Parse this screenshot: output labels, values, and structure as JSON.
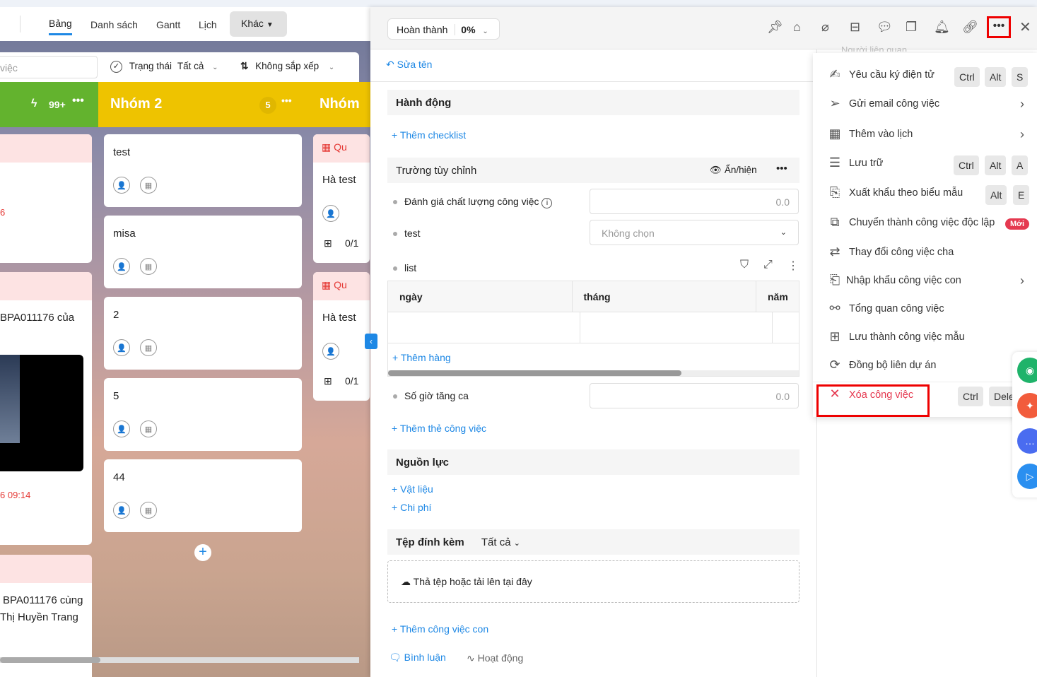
{
  "board": {
    "tabs": [
      "Bảng",
      "Danh sách",
      "Gantt",
      "Lịch"
    ],
    "more_tab": "Khác",
    "search_placeholder": "việc",
    "status_label": "Trạng thái",
    "status_value": "Tất cả",
    "sort_label": "Không sắp xếp",
    "col1": {
      "count": "99+"
    },
    "col2": {
      "title": "Nhóm 2",
      "count": "5"
    },
    "col3": {
      "title": "Nhóm"
    },
    "left_cards": {
      "text1": "6",
      "text2": "BPA011176 của",
      "time": "6 09:14",
      "text3": "BPA011176 cùng",
      "text4": "Thị Huyền Trang"
    },
    "cards": [
      "test",
      "misa",
      "2",
      "5",
      "44"
    ],
    "right_cards": [
      {
        "tag": "Qu",
        "title": "Hà test",
        "sub": "0/1"
      },
      {
        "tag": "Qu",
        "title": "Hà test",
        "sub": "0/1"
      }
    ]
  },
  "panel": {
    "status": "Hoàn thành",
    "progress": "0%",
    "rename": "Sửa tên",
    "actions_title": "Hành động",
    "add_checklist": "Thêm checklist",
    "custom_fields_title": "Trường tùy chỉnh",
    "show_hide": "Ẩn/hiện",
    "fields": [
      {
        "label": "Đánh giá chất lượng công việc",
        "value": "0.0"
      },
      {
        "label": "test",
        "value": "Không chọn"
      },
      {
        "label": "list"
      },
      {
        "label": "Số giờ tăng ca",
        "value": "0.0"
      }
    ],
    "list_columns": [
      "ngày",
      "tháng",
      "năm"
    ],
    "add_row": "Thêm hàng",
    "add_field": "Thêm thẻ công việc",
    "resources_title": "Nguồn lực",
    "materials": "Vật liệu",
    "costs": "Chi phí",
    "attachments_title": "Tệp đính kèm",
    "attachments_filter": "Tất cả",
    "upload": "Thả tệp hoặc tải lên tại đây",
    "add_subtask": "Thêm công việc con",
    "comments_tab": "Bình luận",
    "activity_tab": "Hoạt động"
  },
  "menu": {
    "top_hidden": "Người liên quan",
    "items": [
      {
        "label": "Yêu cầu ký điện tử",
        "keys": [
          "Ctrl",
          "Alt",
          "S"
        ]
      },
      {
        "label": "Gửi email công việc",
        "submenu": true
      },
      {
        "label": "Thêm vào lịch",
        "submenu": true
      },
      {
        "label": "Lưu trữ",
        "keys": [
          "Ctrl",
          "Alt",
          "A"
        ]
      },
      {
        "label": "Xuất khẩu theo biểu mẫu",
        "keys": [
          "Alt",
          "E"
        ]
      },
      {
        "label": "Chuyển thành công việc độc lập",
        "badge": "Mới"
      },
      {
        "label": "Thay đổi công việc cha"
      },
      {
        "label": "Nhập khẩu công việc con",
        "submenu": true
      },
      {
        "label": "Tổng quan công việc"
      },
      {
        "label": "Lưu thành công việc mẫu"
      },
      {
        "label": "Đồng bộ liên dự án"
      },
      {
        "label": "Xóa công việc",
        "keys": [
          "Ctrl",
          "Dele"
        ]
      }
    ]
  },
  "colors": {
    "accent": "#1e88e5",
    "danger": "#e53935",
    "green": "#63b32e",
    "yellow": "#eec300"
  }
}
